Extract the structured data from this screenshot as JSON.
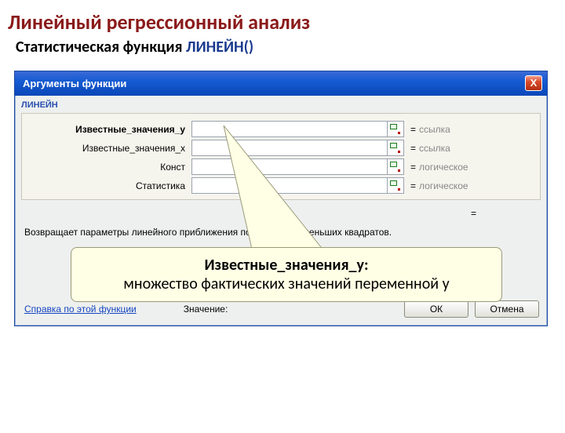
{
  "slide": {
    "title": "Линейный регрессионный анализ",
    "sub_prefix": "Статистическая функция ",
    "sub_fn": "ЛИНЕЙН()"
  },
  "dlg": {
    "title": "Аргументы функции",
    "close": "X",
    "fn": "ЛИНЕЙН",
    "args": [
      {
        "label": "Известные_значения_y",
        "bold": true,
        "val": "ссылка"
      },
      {
        "label": "Известные_значения_x",
        "bold": false,
        "val": "ссылка"
      },
      {
        "label": "Конст",
        "bold": false,
        "val": "логическое"
      },
      {
        "label": "Статистика",
        "bold": false,
        "val": "логическое"
      }
    ],
    "eq": "=",
    "desc": "Возвращает параметры линейного приближения по методу наименьших квадратов.",
    "help": "Справка по этой функции",
    "value_label": "Значение:",
    "ok": "ОК",
    "cancel": "Отмена"
  },
  "callout": {
    "title": "Известные_значения_y:",
    "body": "множество фактических значений переменной y"
  }
}
